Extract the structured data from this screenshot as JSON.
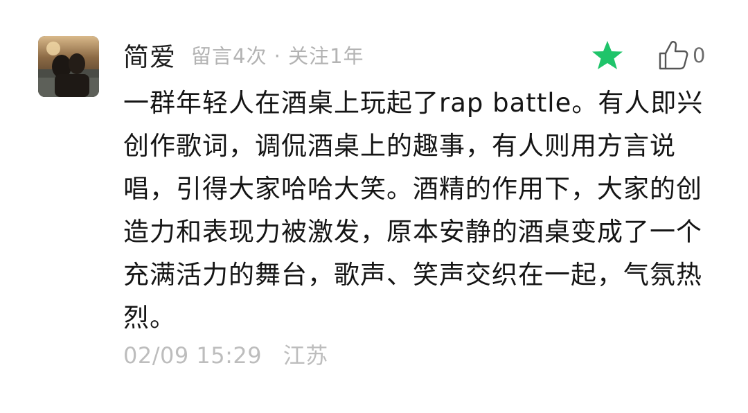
{
  "comment": {
    "nickname": "简爱",
    "meta": "留言4次 · 关注1年",
    "like_count": "0",
    "content": "一群年轻人在酒桌上玩起了rap battle。有人即兴创作歌词，调侃酒桌上的趣事，有人则用方言说唱，引得大家哈哈大笑。酒精的作用下，大家的创造力和表现力被激发，原本安静的酒桌变成了一个充满活力的舞台，歌声、笑声交织在一起，气氛热烈。",
    "time": "02/09 15:29",
    "location": "江苏"
  },
  "icons": {
    "star": "star-icon",
    "like": "thumbs-up-icon"
  },
  "colors": {
    "star": "#1fc46a",
    "meta_text": "#b3b3b3",
    "footer_text": "#bdbdbd"
  }
}
